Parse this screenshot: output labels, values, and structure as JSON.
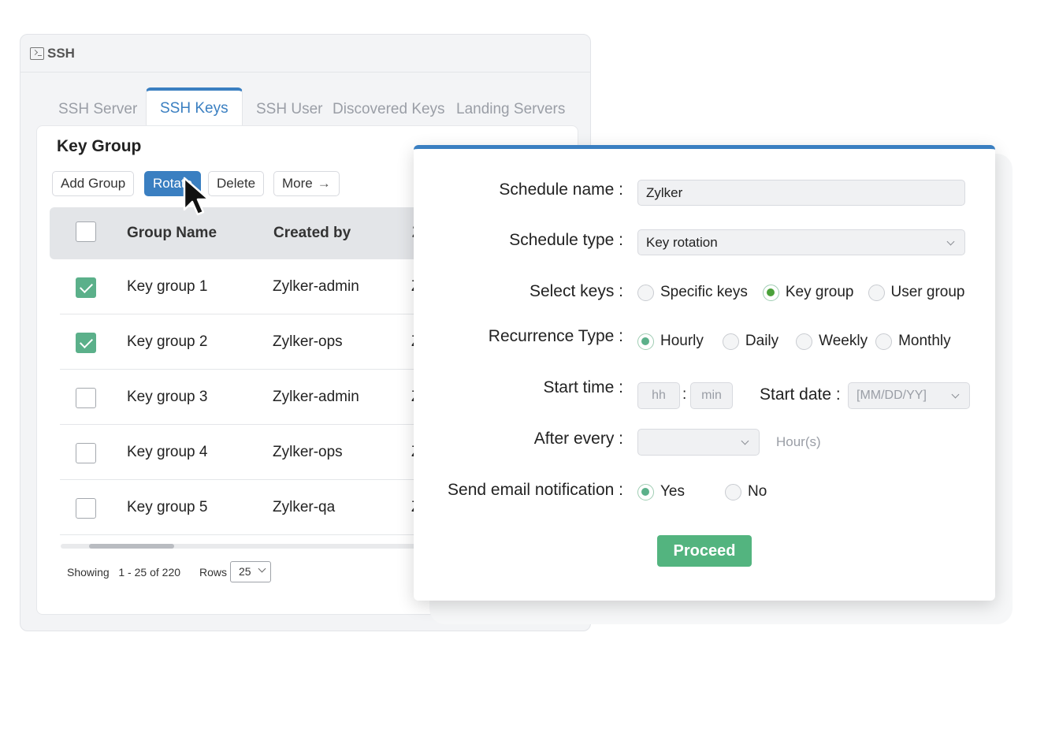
{
  "window": {
    "title": "SSH",
    "tabs": [
      "SSH Server",
      "SSH Keys",
      "SSH User",
      "Discovered Keys",
      "Landing Servers"
    ],
    "active_tab": "SSH Keys"
  },
  "panel": {
    "title": "Key Group",
    "toolbar": {
      "add_group": "Add Group",
      "rotate": "Rotate",
      "delete": "Delete",
      "more": "More",
      "more_arrow": "→"
    },
    "columns": [
      "Group Name",
      "Created by",
      "Z"
    ],
    "rows": [
      {
        "name": "Key group 1",
        "created_by": "Zylker-admin",
        "extra": "Z",
        "checked": true
      },
      {
        "name": "Key group 2",
        "created_by": "Zylker-ops",
        "extra": "Z",
        "checked": true
      },
      {
        "name": "Key group 3",
        "created_by": "Zylker-admin",
        "extra": "Z",
        "checked": false
      },
      {
        "name": "Key group 4",
        "created_by": "Zylker-ops",
        "extra": "Z",
        "checked": false
      },
      {
        "name": "Key group 5",
        "created_by": "Zylker-qa",
        "extra": "Z",
        "checked": false
      }
    ],
    "pager": {
      "showing_label": "Showing",
      "range": "1 - 25",
      "of_label": "of",
      "total": "220",
      "rows_label": "Rows",
      "rows_value": "25"
    }
  },
  "dialog": {
    "schedule_name_label": "Schedule name :",
    "schedule_name_value": "Zylker",
    "schedule_type_label": "Schedule type :",
    "schedule_type_value": "Key rotation",
    "select_keys_label": "Select keys :",
    "select_keys_options": [
      "Specific keys",
      "Key group",
      "User group"
    ],
    "select_keys_selected": "Key group",
    "recurrence_label": "Recurrence Type :",
    "recurrence_options": [
      "Hourly",
      "Daily",
      "Weekly",
      "Monthly"
    ],
    "recurrence_selected": "Hourly",
    "start_time_label": "Start time :",
    "hh_placeholder": "hh",
    "time_separator": ":",
    "min_placeholder": "min",
    "start_date_label": "Start date :",
    "start_date_placeholder": "[MM/DD/YY]",
    "after_every_label": "After every :",
    "after_every_value": "",
    "after_every_unit": "Hour(s)",
    "email_label": "Send email notification :",
    "email_options": [
      "Yes",
      "No"
    ],
    "email_selected": "Yes",
    "proceed_label": "Proceed"
  },
  "colors": {
    "accent": "#3a7fc1",
    "success": "#53b47f",
    "checkbox": "#5bb08a"
  }
}
